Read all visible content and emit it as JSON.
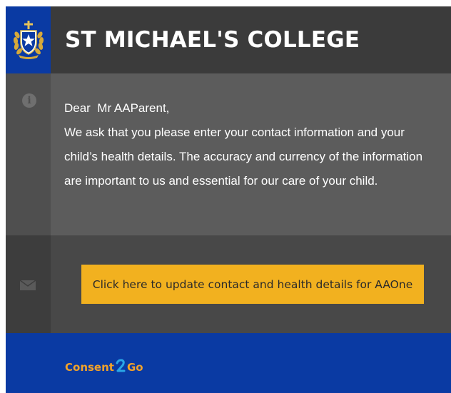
{
  "header": {
    "title": "ST MICHAEL'S COLLEGE",
    "logo_icon": "college-crest-icon",
    "colors": {
      "logo_bg": "#0a3aa3",
      "title_bg": "#3b3b3b"
    }
  },
  "message": {
    "icon": "info-icon",
    "greeting": "Dear  Mr AAParent,",
    "body": "We ask that you please enter your contact information and your child’s health details. The accuracy and currency of the information are important to us and essential for our care of your child."
  },
  "action": {
    "icon": "mail-icon",
    "button_label": "Click here to update contact and health details for AAOne",
    "colors": {
      "button_bg": "#f2b11f"
    }
  },
  "footer": {
    "brand_part1": "Consent",
    "brand_mark": "2",
    "brand_part2": "Go",
    "colors": {
      "bg": "#0a3aa3",
      "brand": "#f2a22a",
      "brand_mark": "#2aa6e6"
    }
  }
}
